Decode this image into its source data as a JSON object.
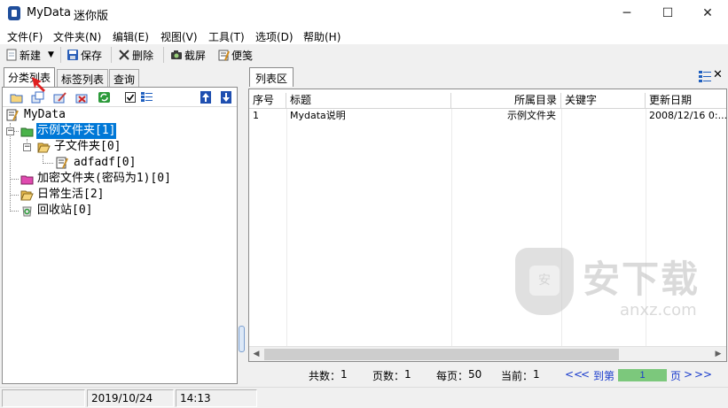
{
  "window": {
    "title": "MyData",
    "subtitle": "迷你版",
    "minimize": "─",
    "maximize": "☐",
    "close": "✕"
  },
  "menu": [
    "文件(F)",
    "文件夹(N)",
    "编辑(E)",
    "视图(V)",
    "工具(T)",
    "选项(D)",
    "帮助(H)"
  ],
  "toolbar": {
    "new_label": "新建",
    "dropdown": "▼",
    "save_label": "保存",
    "delete_label": "删除",
    "screenshot_label": "截屏",
    "note_label": "便笺"
  },
  "left_tabs": [
    "分类列表",
    "标签列表",
    "查询"
  ],
  "left_tab_active": 0,
  "tree": {
    "root": "MyData",
    "nodes": [
      {
        "label": "示例文件夹[1]",
        "selected": true
      },
      {
        "label": "子文件夹[0]"
      },
      {
        "label": "adfadf[0]"
      },
      {
        "label": "加密文件夹(密码为1)[0]"
      },
      {
        "label": "日常生活[2]"
      },
      {
        "label": "回收站[0]"
      }
    ],
    "expanded_symbol": "−"
  },
  "tree_tool_icons": [
    "new-folder-icon",
    "copy-folder-icon",
    "edit-folder-icon",
    "delete-folder-icon",
    "refresh-icon",
    "checkbox-icon",
    "list-icon",
    "move-up-icon",
    "move-down-icon"
  ],
  "right_tab": "列表区",
  "right_close": "✕",
  "grid": {
    "columns": [
      "序号",
      "标题",
      "所属目录",
      "关键字",
      "更新日期"
    ],
    "rows": [
      [
        "1",
        "Mydata说明",
        "示例文件夹",
        "",
        "2008/12/16 0:..."
      ]
    ]
  },
  "watermark": {
    "text": "安下载",
    "sub": "anxz.com",
    "badge": "安"
  },
  "pager": {
    "total_label": "共数：",
    "total": "1",
    "pages_label": "页数：",
    "pages": "1",
    "per_page_label": "每页：",
    "per_page": "50",
    "current_label": "当前：",
    "current": "1",
    "first": "<<",
    "prev": "<",
    "goto": "到第",
    "page_input": "1",
    "page_suffix": "页",
    "next": ">",
    "last": ">>"
  },
  "status": {
    "cell1": "",
    "date": "2019/10/24",
    "time": "14:13"
  },
  "colors": {
    "selection": "#0078d7",
    "link": "#1a3ccc",
    "pager_input": "#7cc87c",
    "arrow": "#e02020"
  }
}
